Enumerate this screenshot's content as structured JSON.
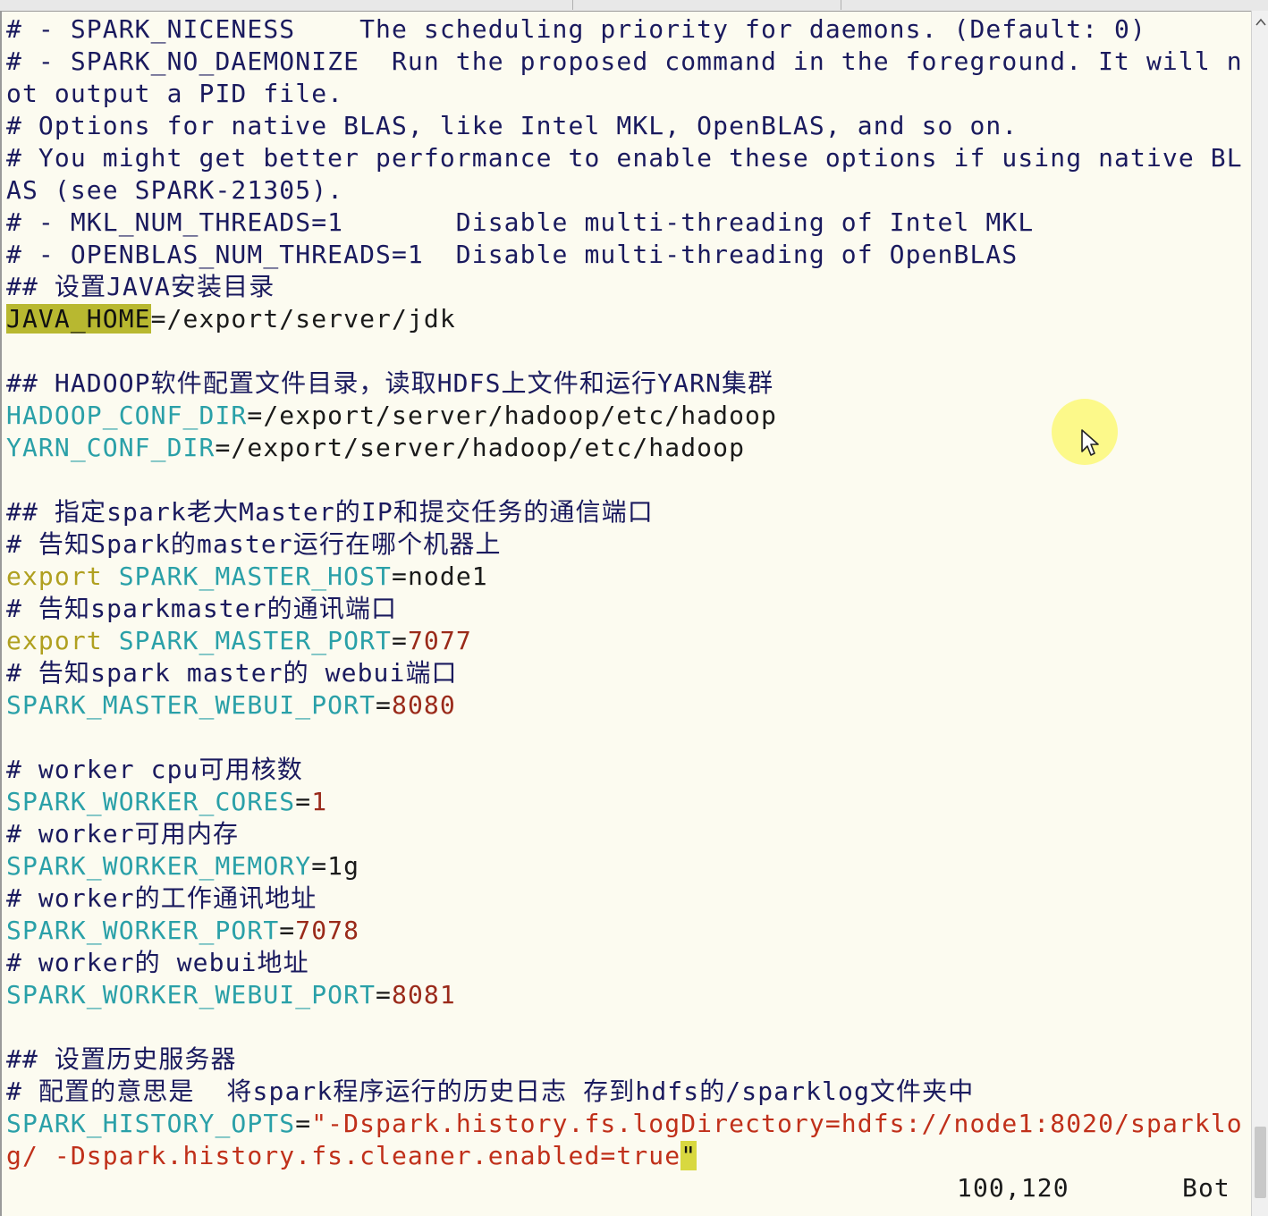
{
  "editor": {
    "lines": [
      [
        {
          "t": "# - SPARK_NICENESS    The scheduling priority for daemons. (Default: 0)",
          "c": "c"
        }
      ],
      [
        {
          "t": "# - SPARK_NO_DAEMONIZE  Run the proposed command in the foreground. It will n",
          "c": "c"
        }
      ],
      [
        {
          "t": "ot output a PID file.",
          "c": "c"
        }
      ],
      [
        {
          "t": "# Options for native BLAS, like Intel MKL, OpenBLAS, and so on.",
          "c": "c"
        }
      ],
      [
        {
          "t": "# You might get better performance to enable these options if using native BL",
          "c": "c"
        }
      ],
      [
        {
          "t": "AS (see SPARK-21305).",
          "c": "c"
        }
      ],
      [
        {
          "t": "# - MKL_NUM_THREADS=1       Disable multi-threading of Intel MKL",
          "c": "c"
        }
      ],
      [
        {
          "t": "# - OPENBLAS_NUM_THREADS=1  Disable multi-threading of OpenBLAS",
          "c": "c"
        }
      ],
      [
        {
          "t": "## 设置JAVA安装目录",
          "c": "c"
        }
      ],
      [
        {
          "t": "JAVA_HOME",
          "c": "hl"
        },
        {
          "t": "=/export/server/jdk",
          "c": ""
        }
      ],
      [],
      [
        {
          "t": "## HADOOP软件配置文件目录，读取HDFS上文件和运行YARN集群",
          "c": "c"
        }
      ],
      [
        {
          "t": "HADOOP_CONF_DIR",
          "c": "var"
        },
        {
          "t": "=/export/server/hadoop/etc/hadoop",
          "c": ""
        }
      ],
      [
        {
          "t": "YARN_CONF_DIR",
          "c": "var"
        },
        {
          "t": "=/export/server/hadoop/etc/hadoop",
          "c": ""
        }
      ],
      [],
      [
        {
          "t": "## 指定spark老大Master的IP和提交任务的通信端口",
          "c": "c"
        }
      ],
      [
        {
          "t": "# 告知Spark的master运行在哪个机器上",
          "c": "c"
        }
      ],
      [
        {
          "t": "export",
          "c": "kw"
        },
        {
          "t": " ",
          "c": ""
        },
        {
          "t": "SPARK_MASTER_HOST",
          "c": "var"
        },
        {
          "t": "=node1",
          "c": ""
        }
      ],
      [
        {
          "t": "# 告知sparkmaster的通讯端口",
          "c": "c"
        }
      ],
      [
        {
          "t": "export",
          "c": "kw"
        },
        {
          "t": " ",
          "c": ""
        },
        {
          "t": "SPARK_MASTER_PORT",
          "c": "var"
        },
        {
          "t": "=",
          "c": ""
        },
        {
          "t": "7077",
          "c": "num"
        }
      ],
      [
        {
          "t": "# 告知spark master的 webui端口",
          "c": "c"
        }
      ],
      [
        {
          "t": "SPARK_MASTER_WEBUI_PORT",
          "c": "var"
        },
        {
          "t": "=",
          "c": ""
        },
        {
          "t": "8080",
          "c": "num"
        }
      ],
      [],
      [
        {
          "t": "# worker cpu可用核数",
          "c": "c"
        }
      ],
      [
        {
          "t": "SPARK_WORKER_CORES",
          "c": "var"
        },
        {
          "t": "=",
          "c": ""
        },
        {
          "t": "1",
          "c": "num"
        }
      ],
      [
        {
          "t": "# worker可用内存",
          "c": "c"
        }
      ],
      [
        {
          "t": "SPARK_WORKER_MEMORY",
          "c": "var"
        },
        {
          "t": "=1g",
          "c": ""
        }
      ],
      [
        {
          "t": "# worker的工作通讯地址",
          "c": "c"
        }
      ],
      [
        {
          "t": "SPARK_WORKER_PORT",
          "c": "var"
        },
        {
          "t": "=",
          "c": ""
        },
        {
          "t": "7078",
          "c": "num"
        }
      ],
      [
        {
          "t": "# worker的 webui地址",
          "c": "c"
        }
      ],
      [
        {
          "t": "SPARK_WORKER_WEBUI_PORT",
          "c": "var"
        },
        {
          "t": "=",
          "c": ""
        },
        {
          "t": "8081",
          "c": "num"
        }
      ],
      [],
      [
        {
          "t": "## 设置历史服务器",
          "c": "c"
        }
      ],
      [
        {
          "t": "# 配置的意思是  将spark程序运行的历史日志 存到hdfs的/sparklog文件夹中",
          "c": "c"
        }
      ],
      [
        {
          "t": "SPARK_HISTORY_OPTS",
          "c": "var"
        },
        {
          "t": "=",
          "c": ""
        },
        {
          "t": "\"-Dspark.history.fs.logDirectory=hdfs://node1:8020/sparklo",
          "c": "str"
        }
      ],
      [
        {
          "t": "g/ -Dspark.history.fs.cleaner.enabled=true",
          "c": "str"
        },
        {
          "t": "\"",
          "c": "cur"
        }
      ]
    ]
  },
  "status": {
    "position": "100,120",
    "scroll": "Bot"
  }
}
